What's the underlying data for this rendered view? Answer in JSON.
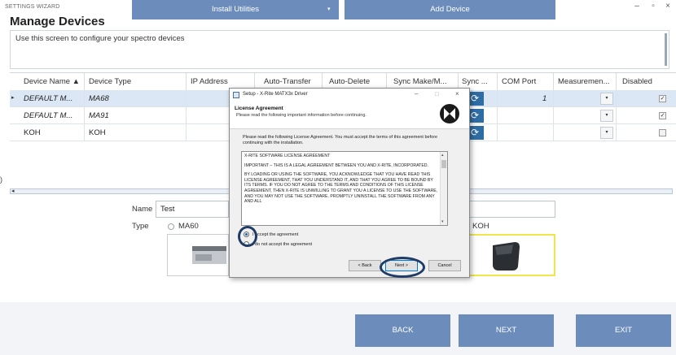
{
  "window": {
    "title": "SETTINGS WIZARD",
    "chevron": "⌄",
    "controls": [
      "–",
      "▫",
      "×"
    ]
  },
  "page": {
    "title": "Manage Devices",
    "description": "Use this screen to configure your spectro devices"
  },
  "grid": {
    "columns": [
      "Device Name ▲",
      "Device Type",
      "IP Address",
      "Auto-Transfer",
      "Auto-Delete",
      "Sync Make/M...",
      "Sync ...",
      "COM Port",
      "Measuremen...",
      "Disabled"
    ],
    "rows": [
      {
        "indicator": "▸",
        "name": "DEFAULT M...",
        "type": "MA68",
        "com_port": "1",
        "disabled": "✓",
        "selected": true,
        "italic": true
      },
      {
        "indicator": "",
        "name": "DEFAULT M...",
        "type": "MA91",
        "com_port": "",
        "disabled": "✓",
        "selected": false,
        "italic": true
      },
      {
        "indicator": "",
        "name": "KOH",
        "type": "KOH",
        "com_port": "",
        "disabled": "",
        "selected": false,
        "italic": false
      }
    ]
  },
  "form": {
    "name_label": "Name",
    "name_value": "Test",
    "type_label": "Type",
    "type_option_1": "MA60",
    "type_option_2": "KOH",
    "left_marker": ")",
    "splitter_arrow": "◂"
  },
  "buttons": {
    "install_utilities": "Install Utilities",
    "install_dropdown": "▾",
    "add_device": "Add Device",
    "back": "BACK",
    "next": "NEXT",
    "exit": "EXIT"
  },
  "dialog": {
    "title": "Setup - X-Rite MATX3x Driver",
    "title_controls": [
      "–",
      "□",
      "×"
    ],
    "heading": "License Agreement",
    "subheading": "Please read the following important information before continuing.",
    "instruction": "Please read the following License Agreement. You must accept the terms of this agreement before continuing with the installation.",
    "license_paragraphs": [
      "X-RITE SOFTWARE LICENSE AGREEMENT",
      "IMPORTANT – THIS IS A LEGAL AGREEMENT BETWEEN YOU AND X-RITE, INCORPORATED.",
      "BY LOADING OR USING THE SOFTWARE, YOU ACKNOWLEDGE THAT YOU HAVE READ THIS LICENSE AGREEMENT, THAT YOU UNDERSTAND IT, AND THAT YOU AGREE TO BE BOUND BY ITS TERMS. IF YOU DO NOT AGREE TO THE TERMS AND CONDITIONS OF THIS LICENSE AGREEMENT, THEN X-RITE IS UNWILLING TO GRANT YOU A LICENSE TO USE THE SOFTWARE, AND YOU MAY NOT USE THE SOFTWARE. PROMPTLY UNINSTALL THE SOFTWARE FROM ANY AND ALL"
    ],
    "scroll_up": "▴",
    "scroll_down": "▾",
    "accept_option": "I accept the agreement",
    "decline_option": "I do not accept the agreement",
    "back_label": "< Back",
    "next_label": "Next >",
    "cancel_label": "Cancel"
  },
  "icons": {
    "sync": "⟳",
    "dropdown": "▾"
  },
  "colors": {
    "accent_button": "#6c8dbc",
    "sync_button": "#2e6da4",
    "selected_row": "#dbe7f4",
    "highlight_circle": "#1f3c66",
    "selected_device_border": "#f0e64c"
  }
}
